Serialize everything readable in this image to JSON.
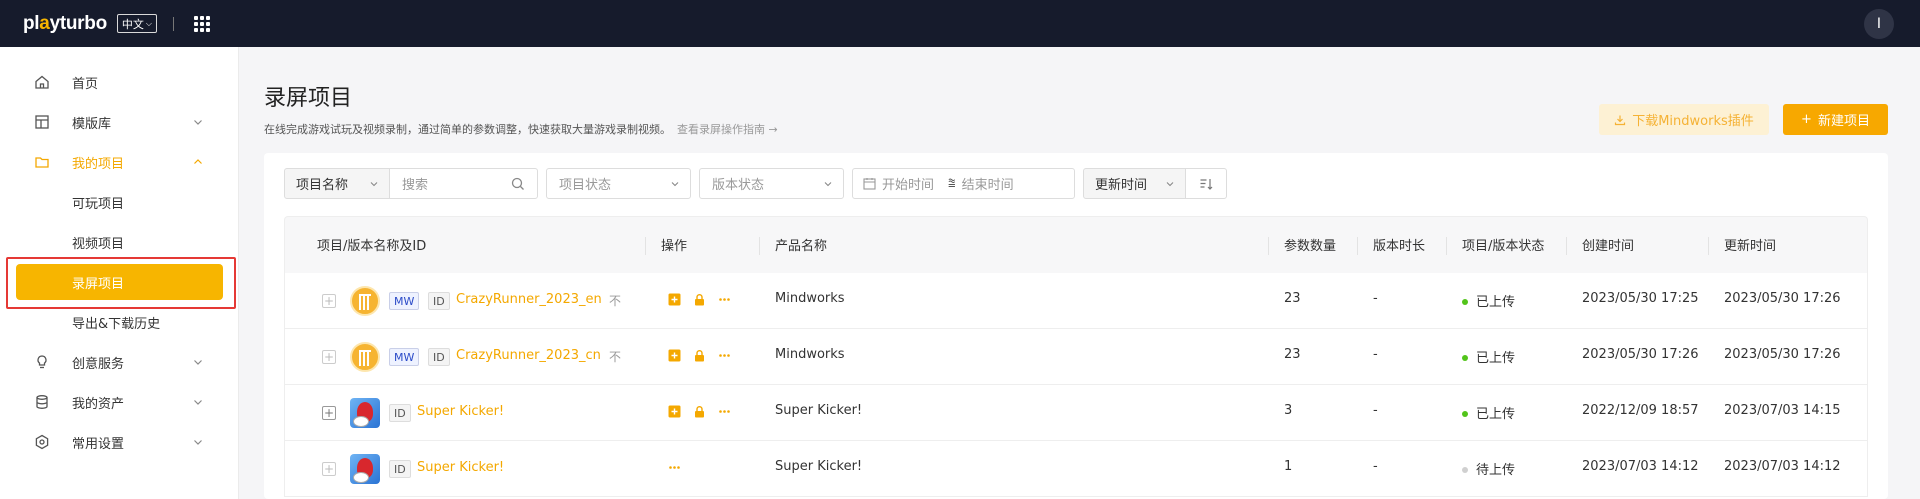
{
  "topbar": {
    "logo_prefix": "pl",
    "logo_o": "a",
    "logo_suffix": "yturbo",
    "lang": "中文",
    "avatar": "I"
  },
  "sidebar": {
    "items": [
      {
        "label": "首页",
        "icon": "home-icon"
      },
      {
        "label": "模版库",
        "icon": "template-icon"
      },
      {
        "label": "我的项目",
        "icon": "folder-icon"
      },
      {
        "label": "创意服务",
        "icon": "bulb-icon"
      },
      {
        "label": "我的资产",
        "icon": "database-icon"
      },
      {
        "label": "常用设置",
        "icon": "settings-icon"
      }
    ],
    "sub_items": [
      "可玩项目",
      "视频项目",
      "录屏项目",
      "导出&下载历史"
    ],
    "active_sub": "录屏项目"
  },
  "header": {
    "title": "录屏项目",
    "description": "在线完成游戏试玩及视频录制，通过简单的参数调整，快速获取大量游戏录制视频。",
    "guide_link": "查看录屏操作指南 →",
    "plugin_button": "下载Mindworks插件",
    "new_button": "新建项目"
  },
  "filters": {
    "field_select": "项目名称",
    "search_placeholder": "搜索",
    "status_placeholder": "项目状态",
    "version_placeholder": "版本状态",
    "start_placeholder": "开始时间",
    "end_placeholder": "结束时间",
    "sort_select": "更新时间"
  },
  "table": {
    "headers": [
      "项目/版本名称及ID",
      "操作",
      "产品名称",
      "参数数量",
      "版本时长",
      "项目/版本状态",
      "创建时间",
      "更新时间"
    ],
    "rows": [
      {
        "thumb": "mindworks-logo",
        "badge": "MW",
        "id_tag": "ID",
        "name": "CrazyRunner_2023_en",
        "flag": "不",
        "product": "Mindworks",
        "params": "23",
        "duration": "-",
        "status": "已上传",
        "status_color": "#52c41a",
        "created": "2023/05/30 17:25",
        "updated": "2023/05/30 17:26"
      },
      {
        "thumb": "mindworks-logo",
        "badge": "MW",
        "id_tag": "ID",
        "name": "CrazyRunner_2023_cn",
        "flag": "不",
        "product": "Mindworks",
        "params": "23",
        "duration": "-",
        "status": "已上传",
        "status_color": "#52c41a",
        "created": "2023/05/30 17:26",
        "updated": "2023/05/30 17:26"
      },
      {
        "thumb": "super-kicker-thumb",
        "badge": "",
        "id_tag": "ID",
        "name": "Super Kicker!",
        "flag": "",
        "product": "Super Kicker!",
        "params": "3",
        "duration": "-",
        "status": "已上传",
        "status_color": "#52c41a",
        "created": "2022/12/09 18:57",
        "updated": "2023/07/03 14:15"
      },
      {
        "thumb": "super-kicker-thumb",
        "badge": "",
        "id_tag": "ID",
        "name": "Super Kicker!",
        "flag": "",
        "product": "Super Kicker!",
        "params": "1",
        "duration": "-",
        "status": "待上传",
        "status_color": "#d0d0d0",
        "created": "2023/07/03 14:12",
        "updated": "2023/07/03 14:12"
      }
    ]
  }
}
